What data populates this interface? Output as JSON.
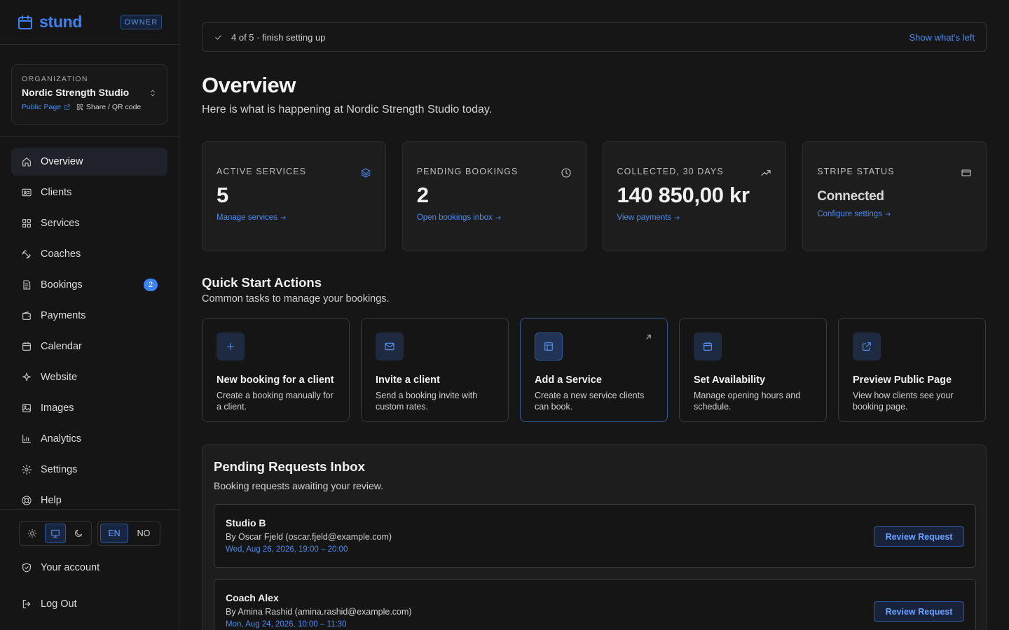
{
  "brand": {
    "name": "stund",
    "role_badge": "OWNER"
  },
  "organization": {
    "label": "ORGANIZATION",
    "name": "Nordic Strength Studio",
    "public_page": "Public Page",
    "share": "Share / QR code"
  },
  "nav": {
    "items": [
      {
        "label": "Overview",
        "icon": "home-icon",
        "active": true
      },
      {
        "label": "Clients",
        "icon": "id-card-icon"
      },
      {
        "label": "Services",
        "icon": "grid-icon"
      },
      {
        "label": "Coaches",
        "icon": "dumbbell-icon"
      },
      {
        "label": "Bookings",
        "icon": "document-icon",
        "badge": "2"
      },
      {
        "label": "Payments",
        "icon": "wallet-icon"
      },
      {
        "label": "Calendar",
        "icon": "calendar-icon"
      },
      {
        "label": "Website",
        "icon": "sparkle-icon"
      },
      {
        "label": "Images",
        "icon": "image-icon"
      },
      {
        "label": "Analytics",
        "icon": "bar-chart-icon"
      },
      {
        "label": "Settings",
        "icon": "gear-icon"
      },
      {
        "label": "Help",
        "icon": "lifebuoy-icon"
      }
    ]
  },
  "theme": {
    "options": [
      "light",
      "system",
      "dark"
    ],
    "selected": "system"
  },
  "language": {
    "options": [
      "EN",
      "NO"
    ],
    "selected": "EN"
  },
  "account": {
    "your_account": "Your account",
    "log_out": "Log Out"
  },
  "setup": {
    "progress_text": "4 of 5 · finish setting up",
    "link": "Show what's left"
  },
  "header": {
    "title": "Overview",
    "subtitle": "Here is what is happening at Nordic Strength Studio today."
  },
  "stats": [
    {
      "label": "ACTIVE SERVICES",
      "value": "5",
      "link": "Manage services",
      "icon": "layers-icon"
    },
    {
      "label": "PENDING BOOKINGS",
      "value": "2",
      "link": "Open bookings inbox",
      "icon": "clock-icon"
    },
    {
      "label": "COLLECTED, 30 DAYS",
      "value": "140 850,00 kr",
      "link": "View payments",
      "icon": "trending-up-icon"
    },
    {
      "label": "STRIPE STATUS",
      "value": "Connected",
      "link": "Configure settings",
      "icon": "credit-card-icon"
    }
  ],
  "quick_start": {
    "title": "Quick Start Actions",
    "subtitle": "Common tasks to manage your bookings.",
    "actions": [
      {
        "title": "New booking for a client",
        "desc": "Create a booking manually for a client.",
        "icon": "plus-icon"
      },
      {
        "title": "Invite a client",
        "desc": "Send a booking invite with custom rates.",
        "icon": "mail-icon"
      },
      {
        "title": "Add a Service",
        "desc": "Create a new service clients can book.",
        "icon": "layout-icon"
      },
      {
        "title": "Set Availability",
        "desc": "Manage opening hours and schedule.",
        "icon": "calendar-icon"
      },
      {
        "title": "Preview Public Page",
        "desc": "View how clients see your booking page.",
        "icon": "external-link-icon"
      }
    ]
  },
  "inbox": {
    "title": "Pending Requests Inbox",
    "subtitle": "Booking requests awaiting your review.",
    "requests": [
      {
        "title": "Studio B",
        "by": "By Oscar Fjeld (oscar.fjeld@example.com)",
        "time": "Wed, Aug 26, 2026, 19:00 – 20:00",
        "button": "Review Request"
      },
      {
        "title": "Coach Alex",
        "by": "By Amina Rashid (amina.rashid@example.com)",
        "time": "Mon, Aug 24, 2026, 10:00 – 11:30",
        "button": "Review Request"
      }
    ]
  },
  "colors": {
    "accent": "#3b82f6",
    "background": "#161616",
    "surface": "#1d1d1d"
  }
}
